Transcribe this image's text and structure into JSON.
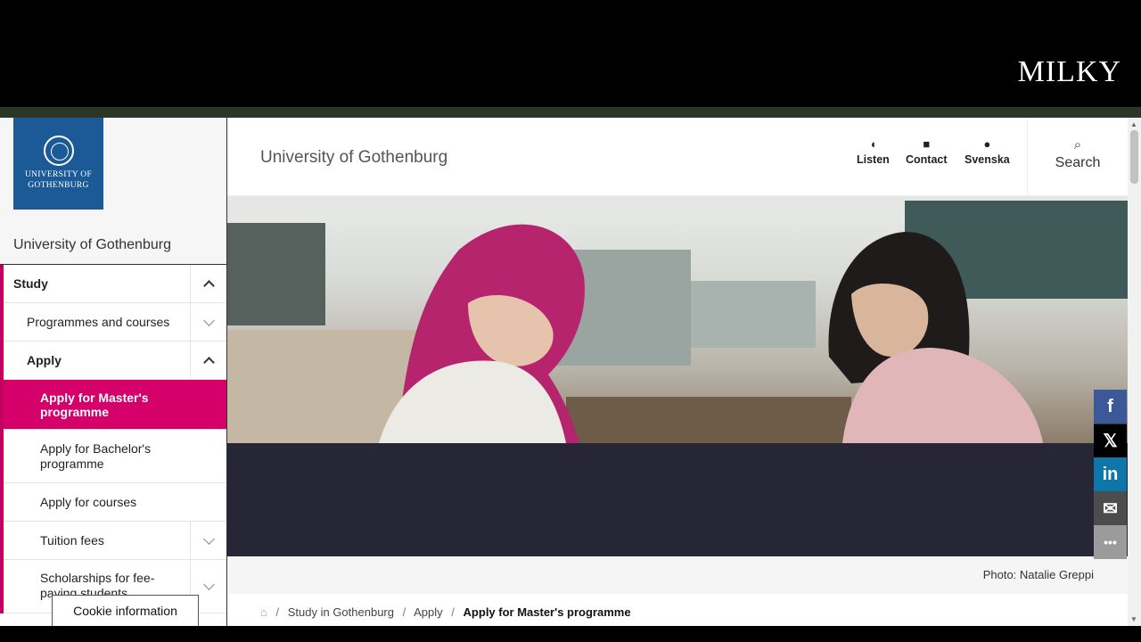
{
  "brand": "MILKY",
  "logo": {
    "line1": "UNIVERSITY OF",
    "line2": "GOTHENBURG"
  },
  "sidebar": {
    "title": "University of Gothenburg",
    "items": [
      {
        "label": "Study",
        "toggle": "up"
      },
      {
        "label": "Programmes and courses",
        "toggle": "down"
      },
      {
        "label": "Apply",
        "toggle": "up"
      },
      {
        "label": "Apply for Master's programme"
      },
      {
        "label": "Apply for Bachelor's programme"
      },
      {
        "label": "Apply for courses"
      },
      {
        "label": "Tuition fees",
        "toggle": "down"
      },
      {
        "label": "Scholarships for fee-paying students",
        "toggle": "down"
      }
    ]
  },
  "cookie": "Cookie information",
  "header": {
    "site_name": "University of Gothenburg",
    "listen": "Listen",
    "contact": "Contact",
    "svenska": "Svenska",
    "search": "Search"
  },
  "hero": {
    "caption": "Photo: Natalie Greppi"
  },
  "breadcrumb": [
    "Study in Gothenburg",
    "Apply",
    "Apply for Master's programme"
  ],
  "share": [
    {
      "name": "facebook-icon",
      "glyph": "f",
      "color": "#3b5998"
    },
    {
      "name": "x-icon",
      "glyph": "𝕏",
      "color": "#000000"
    },
    {
      "name": "linkedin-icon",
      "glyph": "in",
      "color": "#0e76a8"
    },
    {
      "name": "email-icon",
      "glyph": "✉",
      "color": "#4c4c4c"
    },
    {
      "name": "more-icon",
      "glyph": "•••",
      "color": "#9b9b9b"
    }
  ]
}
